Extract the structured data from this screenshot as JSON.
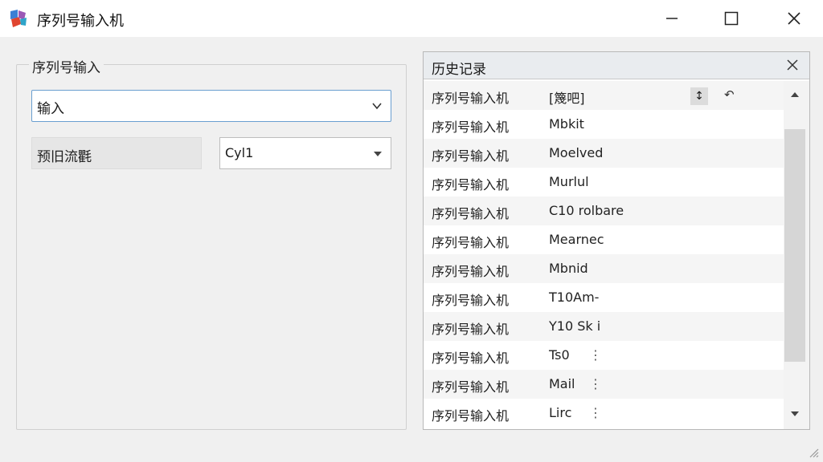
{
  "window": {
    "title": "序列号输入机"
  },
  "left_panel": {
    "group_title": "序列号输入",
    "input_combo": {
      "value": "输入"
    },
    "label": "预旧流氍",
    "small_combo": {
      "value": "Cyl1"
    }
  },
  "history": {
    "title": "历史记录",
    "rows": [
      {
        "name": "序列号输入机",
        "value": "[篾吧]"
      },
      {
        "name": "序列号输入机",
        "value": "Mbkit"
      },
      {
        "name": "序列号输入机",
        "value": "Moelved"
      },
      {
        "name": "序列号输入机",
        "value": "Murlul"
      },
      {
        "name": "序列号输入机",
        "value": "C10 rolbare"
      },
      {
        "name": "序列号输入机",
        "value": "Mearnec"
      },
      {
        "name": "序列号输入机",
        "value": "Mbnid"
      },
      {
        "name": "序列号输入机",
        "value": "T10Am-"
      },
      {
        "name": "序列号输入机",
        "value": "Y10 Sk i"
      },
      {
        "name": "序列号输入机",
        "value": "Ts0",
        "more": "⋮"
      },
      {
        "name": "序列号输入机",
        "value": "Mail",
        "more": "⋮"
      },
      {
        "name": "序列号输入机",
        "value": "Lirc",
        "more": "⋮"
      }
    ]
  },
  "colors": {
    "accent_border": "#6a9fd0",
    "background": "#f0f0f0"
  }
}
